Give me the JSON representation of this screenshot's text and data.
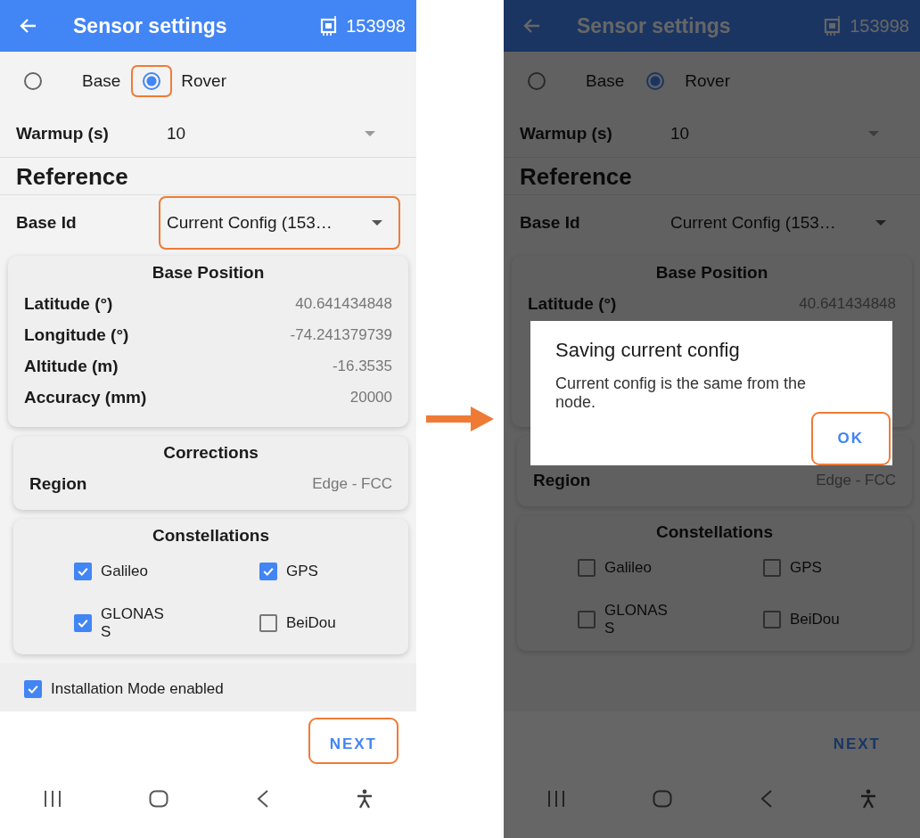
{
  "screens": [
    {
      "title": "Sensor settings",
      "device_id": "153998",
      "dimmed": false,
      "modes": [
        {
          "label": "Base",
          "selected": false,
          "highlighted": false
        },
        {
          "label": "Rover",
          "selected": true,
          "highlighted": true
        }
      ],
      "warmup": {
        "label": "Warmup (s)",
        "value": "10"
      },
      "section_title": "Reference",
      "base_id": {
        "label": "Base Id",
        "value": "Current Config (153…",
        "highlighted": true
      },
      "base_position": {
        "title": "Base Position",
        "rows": [
          {
            "label": "Latitude (°)",
            "value": "40.641434848"
          },
          {
            "label": "Longitude (°)",
            "value": "-74.241379739"
          },
          {
            "label": "Altitude (m)",
            "value": "-16.3535"
          },
          {
            "label": "Accuracy (mm)",
            "value": "20000"
          }
        ]
      },
      "corrections": {
        "title": "Corrections",
        "rows": [
          {
            "label": "Region",
            "value": "Edge - FCC"
          }
        ]
      },
      "constellations": {
        "title": "Constellations",
        "items": [
          {
            "label": "Galileo",
            "checked": true
          },
          {
            "label": "GPS",
            "checked": true
          },
          {
            "label": "GLONASS",
            "checked": true
          },
          {
            "label": "BeiDou",
            "checked": false
          }
        ]
      },
      "installation_mode": {
        "label": "Installation Mode enabled",
        "checked": true
      },
      "next_button": {
        "label": "NEXT",
        "highlighted": true
      }
    },
    {
      "title": "Sensor settings",
      "device_id": "153998",
      "dimmed": true,
      "modes": [
        {
          "label": "Base",
          "selected": false,
          "highlighted": false
        },
        {
          "label": "Rover",
          "selected": true,
          "highlighted": false
        }
      ],
      "warmup": {
        "label": "Warmup (s)",
        "value": "10"
      },
      "section_title": "Reference",
      "base_id": {
        "label": "Base Id",
        "value": "Current Config (153…",
        "highlighted": false
      },
      "base_position": {
        "title": "Base Position",
        "rows": [
          {
            "label": "Latitude (°)",
            "value": "40.641434848"
          }
        ]
      },
      "corrections": {
        "rows": [
          {
            "label": "Region",
            "value": "Edge - FCC"
          }
        ]
      },
      "constellations": {
        "title": "Constellations",
        "items": [
          {
            "label": "Galileo",
            "checked": false
          },
          {
            "label": "GPS",
            "checked": false
          },
          {
            "label": "GLONASS",
            "checked": false
          },
          {
            "label": "BeiDou",
            "checked": false
          }
        ]
      },
      "next_button": {
        "label": "NEXT",
        "highlighted": false
      },
      "dialog": {
        "title": "Saving current config",
        "message": "Current config is the same from the node.",
        "button": {
          "label": "OK",
          "highlighted": true
        }
      }
    }
  ]
}
